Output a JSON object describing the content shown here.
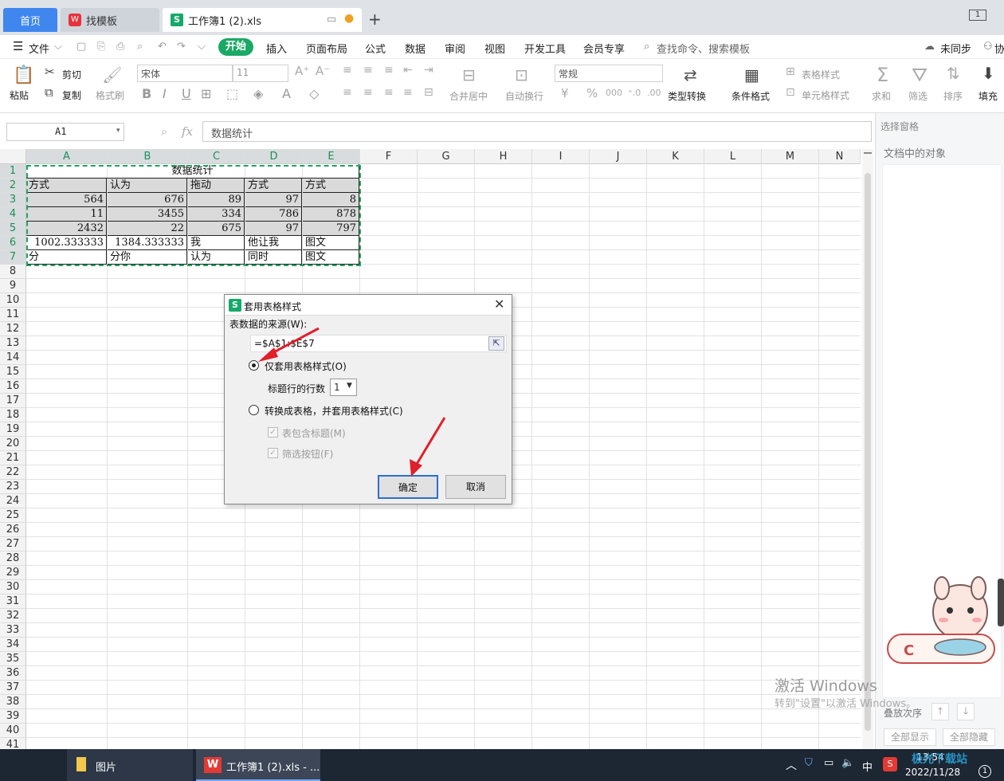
{
  "tabs": {
    "home": "首页",
    "template": "找模板",
    "doc": "工作簿1 (2).xls",
    "add": "+",
    "page_indicator": "1"
  },
  "menu": {
    "file": "文件",
    "start": "开始",
    "insert": "插入",
    "layout": "页面布局",
    "formula": "公式",
    "data": "数据",
    "review": "审阅",
    "view": "视图",
    "dev": "开发工具",
    "member": "会员专享",
    "search": "查找命令、搜索模板",
    "sync": "未同步",
    "collab": "协"
  },
  "ribbon": {
    "paste": "粘贴",
    "cut": "剪切",
    "copy": "复制",
    "format_painter": "格式刷",
    "font_name": "宋体",
    "font_size": "11",
    "number_format": "常规",
    "merge": "合并居中",
    "wrap": "自动换行",
    "type_convert": "类型转换",
    "cond_format": "条件格式",
    "table_style": "表格样式",
    "cell_style": "单元格样式",
    "sum": "求和",
    "filter": "筛选",
    "sort": "排序",
    "fill": "填充"
  },
  "formula_bar": {
    "name_box": "A1",
    "fx": "fx",
    "content": "数据统计"
  },
  "columns": [
    "A",
    "B",
    "C",
    "D",
    "E",
    "F",
    "G",
    "H",
    "I",
    "J",
    "K",
    "L",
    "M",
    "N"
  ],
  "rows": [
    "1",
    "2",
    "3",
    "4",
    "5",
    "6",
    "7",
    "8",
    "9",
    "10",
    "11",
    "12",
    "13",
    "14",
    "15",
    "16",
    "17",
    "18",
    "19",
    "20",
    "21",
    "22",
    "23",
    "24",
    "25",
    "26",
    "27",
    "28",
    "29",
    "30",
    "31",
    "32",
    "33",
    "34",
    "35",
    "36",
    "37",
    "38",
    "39",
    "40",
    "41"
  ],
  "sheet": {
    "title": "数据统计",
    "r2": [
      "方式",
      "认为",
      "拖动",
      "方式",
      "方式"
    ],
    "r3": [
      "564",
      "676",
      "89",
      "97",
      "8"
    ],
    "r4": [
      "11",
      "3455",
      "334",
      "786",
      "878"
    ],
    "r5": [
      "2432",
      "22",
      "675",
      "97",
      "797"
    ],
    "r6": [
      "1002.333333",
      "1384.333333",
      "我",
      "他让我",
      "图文"
    ],
    "r7": [
      "分",
      "分你",
      "认为",
      "同时",
      "图文"
    ]
  },
  "side_panel": {
    "header": "选择窗格",
    "objects": "文档中的对象",
    "order": "叠放次序",
    "show_all": "全部显示",
    "hide_all": "全部隐藏"
  },
  "dialog": {
    "title": "套用表格样式",
    "source_label": "表数据的来源(W):",
    "source_value": "=$A$1:$E$7",
    "opt1": "仅套用表格样式(O)",
    "header_rows_label": "标题行的行数",
    "header_rows_value": "1",
    "opt2": "转换成表格，并套用表格样式(C)",
    "chk1": "表包含标题(M)",
    "chk2": "筛选按钮(F)",
    "ok": "确定",
    "cancel": "取消"
  },
  "watermark": {
    "line1": "激活 Windows",
    "line2": "转到\"设置\"以激活 Windows。"
  },
  "taskbar": {
    "pictures": "图片",
    "wps": "工作簿1 (2).xls - ...",
    "time": "13:54",
    "date": "2022/11/28",
    "ime": "中",
    "notif": "1",
    "brand": "极光下载站"
  },
  "colors": {
    "accent_green": "#1aa964",
    "tab_blue": "#3f86ef",
    "arrow_red": "#e0202a"
  }
}
